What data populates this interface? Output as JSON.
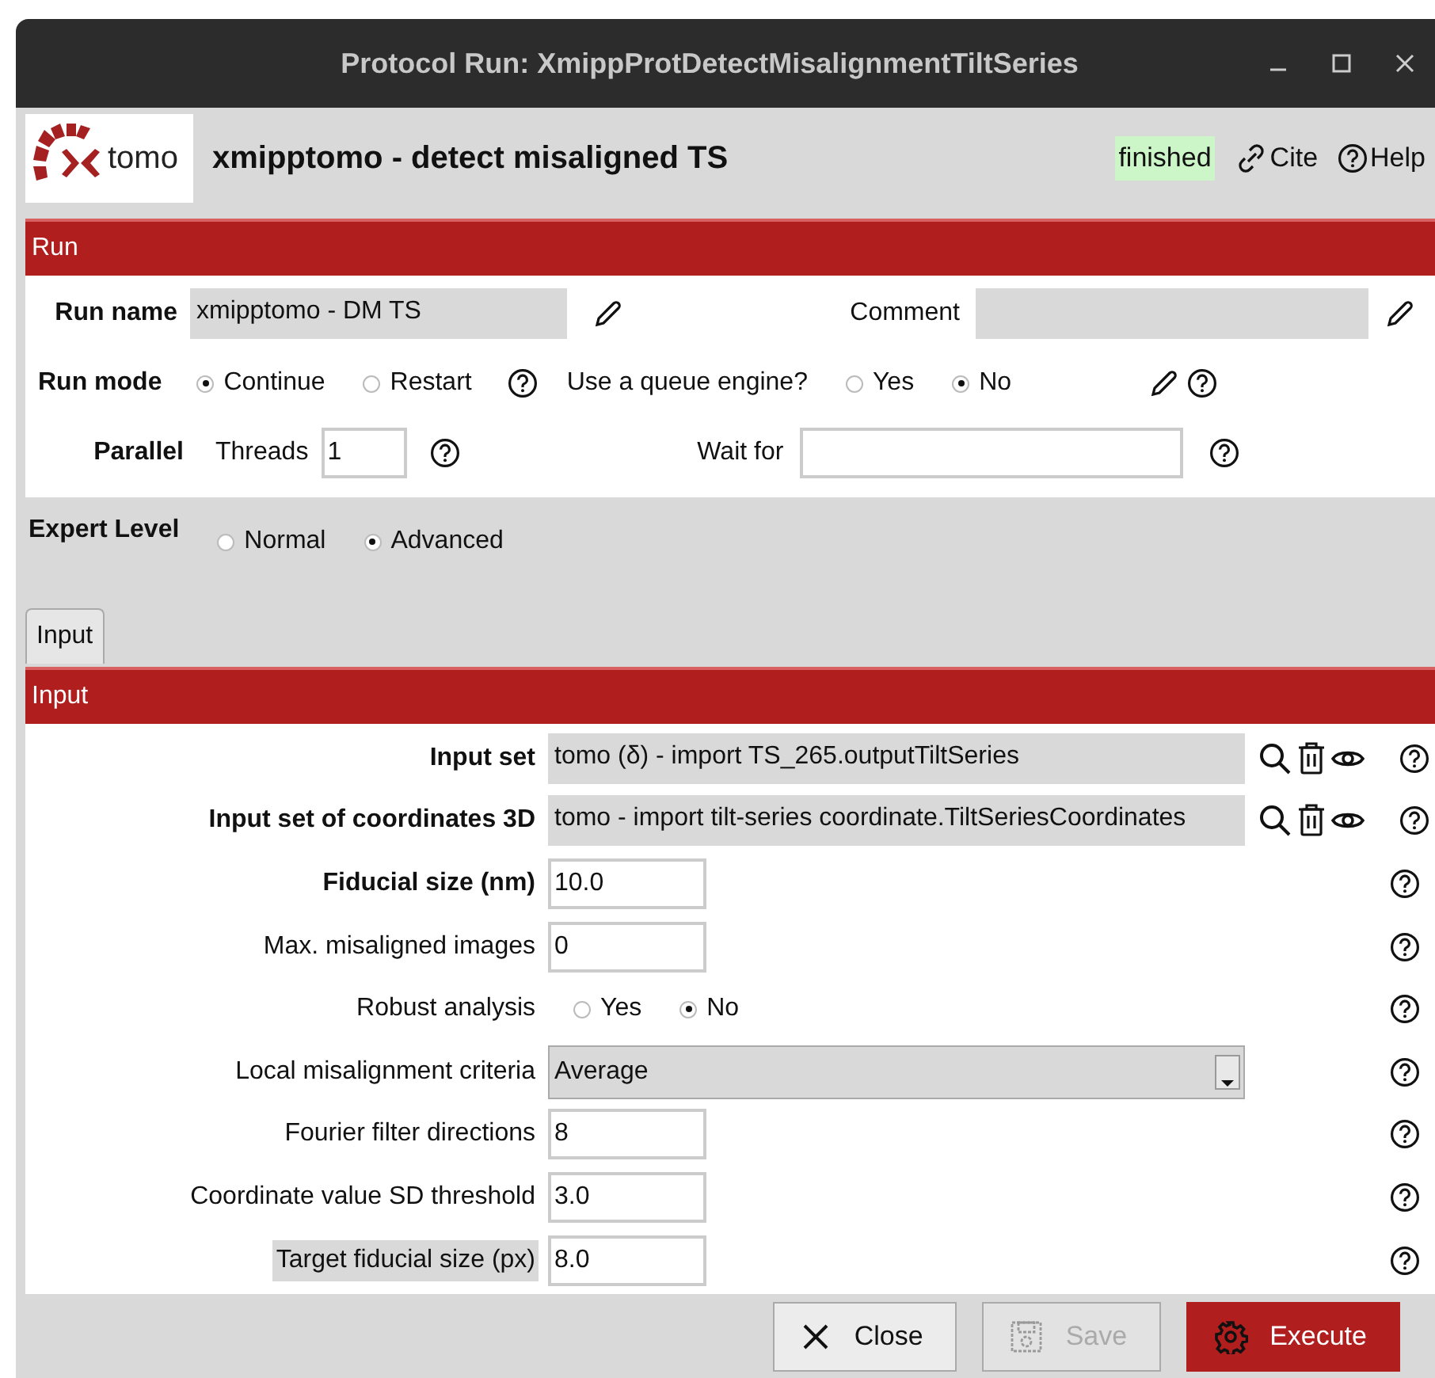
{
  "window": {
    "title": "Protocol Run: XmippProtDetectMisalignmentTiltSeries"
  },
  "header": {
    "protocol": "xmipptomo - detect misaligned TS",
    "status": "finished",
    "links": [
      {
        "kind": "cite",
        "label": "Cite"
      },
      {
        "kind": "help",
        "label": "Help"
      }
    ],
    "logo_text": "tomo"
  },
  "run_section": {
    "title": "Run",
    "run_name": {
      "label": "Run name",
      "value": "xmipptomo - DM TS"
    },
    "comment": {
      "label": "Comment"
    },
    "run_mode": {
      "label": "Run mode",
      "options": [
        {
          "label": "Continue",
          "selected": true
        },
        {
          "label": "Restart",
          "selected": false
        }
      ]
    },
    "queue": {
      "label": "Use a queue engine?",
      "options": [
        {
          "label": "Yes",
          "selected": false
        },
        {
          "label": "No",
          "selected": true
        }
      ]
    },
    "parallel": {
      "label": "Parallel",
      "threads_label": "Threads",
      "threads_value": "1"
    },
    "wait_for": {
      "label": "Wait for"
    }
  },
  "expert_level": {
    "label": "Expert Level",
    "options": [
      {
        "label": "Normal",
        "selected": false
      },
      {
        "label": "Advanced",
        "selected": true
      }
    ]
  },
  "tabs": [
    {
      "label": "Input",
      "selected": true
    }
  ],
  "input_section": {
    "title": "Input",
    "params": [
      {
        "kind": "pointer",
        "label": "Input set",
        "bold": true,
        "highlighted": false,
        "value": "tomo (δ) - import TS_265.outputTiltSeries"
      },
      {
        "kind": "pointer",
        "label": "Input set of coordinates 3D",
        "bold": true,
        "highlighted": false,
        "value": "tomo - import tilt-series coordinate.TiltSeriesCoordinates"
      },
      {
        "kind": "text",
        "label": "Fiducial size (nm)",
        "bold": true,
        "highlighted": false,
        "value": "10.0"
      },
      {
        "kind": "text",
        "label": "Max. misaligned images",
        "bold": false,
        "highlighted": false,
        "value": "0"
      },
      {
        "kind": "radio",
        "label": "Robust analysis",
        "bold": false,
        "highlighted": false,
        "options": [
          {
            "label": "Yes",
            "selected": false
          },
          {
            "label": "No",
            "selected": true
          }
        ]
      },
      {
        "kind": "select",
        "label": "Local misalignment criteria",
        "bold": false,
        "highlighted": false,
        "value": "Average"
      },
      {
        "kind": "text",
        "label": "Fourier filter directions",
        "bold": false,
        "highlighted": false,
        "value": "8"
      },
      {
        "kind": "text",
        "label": "Coordinate value SD threshold",
        "bold": false,
        "highlighted": false,
        "value": "3.0"
      },
      {
        "kind": "text",
        "label": "Target fiducial size (px)",
        "bold": false,
        "highlighted": true,
        "value": "8.0"
      }
    ]
  },
  "buttons": [
    {
      "kind": "close",
      "label": "Close",
      "disabled": false
    },
    {
      "kind": "save",
      "label": "Save",
      "disabled": true
    },
    {
      "kind": "execute",
      "label": "Execute",
      "disabled": false
    }
  ]
}
